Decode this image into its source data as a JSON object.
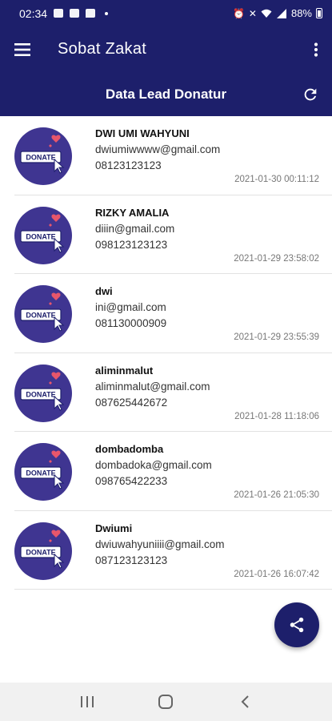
{
  "status_bar": {
    "time": "02:34",
    "battery": "88%"
  },
  "app_bar": {
    "title": "Sobat Zakat",
    "menu_icon": "hamburger-icon",
    "more_icon": "more-vert-icon"
  },
  "sub_header": {
    "title": "Data Lead Donatur",
    "refresh_icon": "refresh-icon"
  },
  "avatar": {
    "icon": "donate-icon",
    "label": "DONATE",
    "colors": {
      "circle": "#3f3591",
      "badge": "#ffffff",
      "heart": "#e8566b"
    }
  },
  "leads": [
    {
      "name": "DWI UMI WAHYUNI",
      "email": "dwiumiwwww@gmail.com",
      "phone": "08123123123",
      "date": "2021-01-30 00:11:12"
    },
    {
      "name": "RIZKY AMALIA",
      "email": "diiin@gmail.com",
      "phone": "098123123123",
      "date": "2021-01-29 23:58:02"
    },
    {
      "name": "dwi",
      "email": "ini@gmail.com",
      "phone": "081130000909",
      "date": "2021-01-29 23:55:39"
    },
    {
      "name": "aliminmalut",
      "email": "aliminmalut@gmail.com",
      "phone": "087625442672",
      "date": "2021-01-28 11:18:06"
    },
    {
      "name": "dombadomba",
      "email": "dombadoka@gmail.com",
      "phone": "098765422233",
      "date": "2021-01-26 21:05:30"
    },
    {
      "name": "Dwiumi",
      "email": "dwiuwahyuniiii@gmail.com",
      "phone": "087123123123",
      "date": "2021-01-26 16:07:42"
    }
  ],
  "fab": {
    "icon": "share-icon"
  },
  "nav_bar": {
    "recents_icon": "recents-icon",
    "home_icon": "home-icon",
    "back_icon": "back-icon"
  },
  "colors": {
    "primary": "#1d1f6b",
    "divider": "#e2e2e2",
    "nav_bg": "#f1f1f1"
  }
}
